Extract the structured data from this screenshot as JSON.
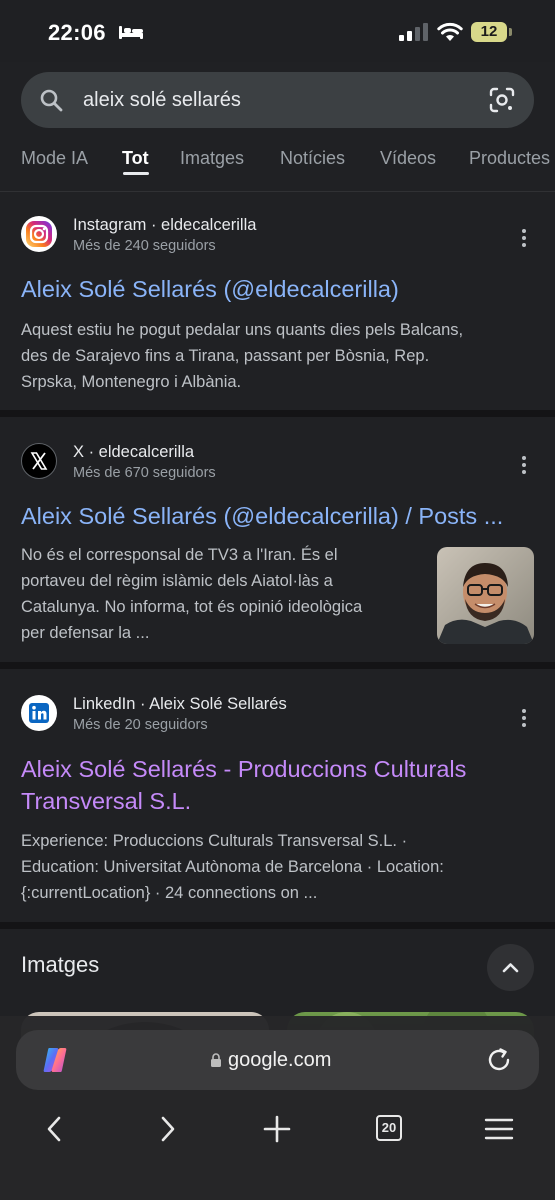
{
  "status_bar": {
    "time": "22:06",
    "battery_level": "12"
  },
  "search": {
    "query": "aleix solé sellarés"
  },
  "tabs": [
    {
      "label": "Mode IA",
      "active": false
    },
    {
      "label": "Tot",
      "active": true
    },
    {
      "label": "Imatges",
      "active": false
    },
    {
      "label": "Notícies",
      "active": false
    },
    {
      "label": "Vídeos",
      "active": false
    },
    {
      "label": "Productes",
      "active": false
    }
  ],
  "results": [
    {
      "source": "Instagram · eldecalcerilla",
      "followers": "Més de 240 seguidors",
      "title": "Aleix Solé Sellarés (@eldecalcerilla)",
      "snippet_lines": [
        "Aquest estiu he pogut pedalar uns quants dies pels Balcans,",
        "des de Sarajevo fins a Tirana, passant per Bòsnia, Rep.",
        "Srpska, Montenegro i Albània."
      ],
      "icon": "instagram-logo"
    },
    {
      "source": "X · eldecalcerilla",
      "followers": "Més de 670 seguidors",
      "title": "Aleix Solé Sellarés (@eldecalcerilla) / Posts ...",
      "snippet_lines": [
        "No és el corresponsal de TV3 a l'Iran. És el",
        "portaveu del règim islàmic dels Aiatol·làs a",
        "Catalunya. No informa, tot és opinió ideològica",
        "per defensar la ..."
      ],
      "icon": "x-logo"
    },
    {
      "source": "LinkedIn · Aleix Solé Sellarés",
      "followers": "Més de 20 seguidors",
      "title_lines": [
        "Aleix Solé Sellarés - Produccions Culturals",
        "Transversal S.L."
      ],
      "snippet_lines": [
        "Experience: Produccions Culturals Transversal S.L. ·",
        "Education: Universitat Autònoma de Barcelona · Location:",
        "{:currentLocation} · 24 connections on ..."
      ],
      "icon": "linkedin-logo"
    }
  ],
  "images_section": {
    "heading": "Imatges"
  },
  "browser_bar": {
    "url": "google.com",
    "tab_count": "20"
  },
  "colors": {
    "background": "#202124",
    "link": "#8ab4f8",
    "visited_link": "#c58af9",
    "snippet_text": "#bdc1c6",
    "muted_text": "#9aa0a6"
  }
}
